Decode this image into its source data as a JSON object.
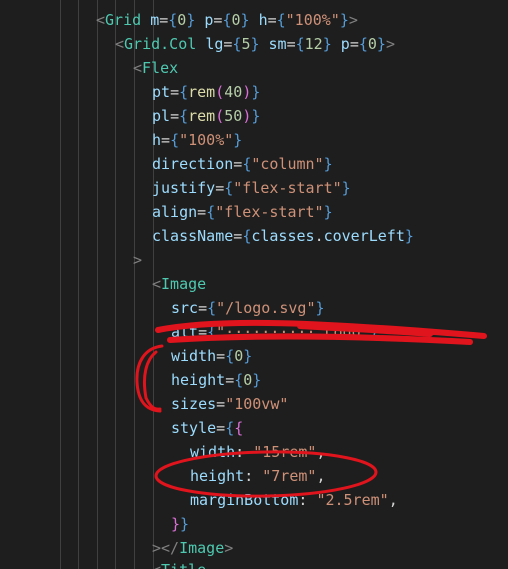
{
  "editor": {
    "lines": [
      [
        [
          "tag",
          "<"
        ],
        [
          "comp",
          "Grid"
        ],
        [
          "op",
          " "
        ],
        [
          "attr",
          "m"
        ],
        [
          "op",
          "="
        ],
        [
          "br",
          "{"
        ],
        [
          "num",
          "0"
        ],
        [
          "br",
          "}"
        ],
        [
          "op",
          " "
        ],
        [
          "attr",
          "p"
        ],
        [
          "op",
          "="
        ],
        [
          "br",
          "{"
        ],
        [
          "num",
          "0"
        ],
        [
          "br",
          "}"
        ],
        [
          "op",
          " "
        ],
        [
          "attr",
          "h"
        ],
        [
          "op",
          "="
        ],
        [
          "br",
          "{"
        ],
        [
          "str",
          "\"100%\""
        ],
        [
          "br",
          "}"
        ],
        [
          "tag",
          ">"
        ]
      ],
      [
        [
          "tag",
          "<"
        ],
        [
          "comp",
          "Grid.Col"
        ],
        [
          "op",
          " "
        ],
        [
          "attr",
          "lg"
        ],
        [
          "op",
          "="
        ],
        [
          "br",
          "{"
        ],
        [
          "num",
          "5"
        ],
        [
          "br",
          "}"
        ],
        [
          "op",
          " "
        ],
        [
          "attr",
          "sm"
        ],
        [
          "op",
          "="
        ],
        [
          "br",
          "{"
        ],
        [
          "num",
          "12"
        ],
        [
          "br",
          "}"
        ],
        [
          "op",
          " "
        ],
        [
          "attr",
          "p"
        ],
        [
          "op",
          "="
        ],
        [
          "br",
          "{"
        ],
        [
          "num",
          "0"
        ],
        [
          "br",
          "}"
        ],
        [
          "tag",
          ">"
        ]
      ],
      [
        [
          "tag",
          "<"
        ],
        [
          "comp",
          "Flex"
        ]
      ],
      [
        [
          "attr",
          "pt"
        ],
        [
          "op",
          "="
        ],
        [
          "br",
          "{"
        ],
        [
          "fn",
          "rem"
        ],
        [
          "br2",
          "("
        ],
        [
          "num",
          "40"
        ],
        [
          "br2",
          ")"
        ],
        [
          "br",
          "}"
        ]
      ],
      [
        [
          "attr",
          "pl"
        ],
        [
          "op",
          "="
        ],
        [
          "br",
          "{"
        ],
        [
          "fn",
          "rem"
        ],
        [
          "br2",
          "("
        ],
        [
          "num",
          "50"
        ],
        [
          "br2",
          ")"
        ],
        [
          "br",
          "}"
        ]
      ],
      [
        [
          "attr",
          "h"
        ],
        [
          "op",
          "="
        ],
        [
          "br",
          "{"
        ],
        [
          "str",
          "\"100%\""
        ],
        [
          "br",
          "}"
        ]
      ],
      [
        [
          "attr",
          "direction"
        ],
        [
          "op",
          "="
        ],
        [
          "br",
          "{"
        ],
        [
          "str",
          "\"column\""
        ],
        [
          "br",
          "}"
        ]
      ],
      [
        [
          "attr",
          "justify"
        ],
        [
          "op",
          "="
        ],
        [
          "br",
          "{"
        ],
        [
          "str",
          "\"flex-start\""
        ],
        [
          "br",
          "}"
        ]
      ],
      [
        [
          "attr",
          "align"
        ],
        [
          "op",
          "="
        ],
        [
          "br",
          "{"
        ],
        [
          "str",
          "\"flex-start\""
        ],
        [
          "br",
          "}"
        ]
      ],
      [
        [
          "attr",
          "className"
        ],
        [
          "op",
          "="
        ],
        [
          "br",
          "{"
        ],
        [
          "attr",
          "classes"
        ],
        [
          "op",
          "."
        ],
        [
          "attr",
          "coverLeft"
        ],
        [
          "br",
          "}"
        ]
      ],
      [
        [
          "fold",
          ">"
        ]
      ],
      [
        [
          "tag",
          "<"
        ],
        [
          "comp",
          "Image"
        ]
      ],
      [
        [
          "attr",
          "src"
        ],
        [
          "op",
          "="
        ],
        [
          "br",
          "{"
        ],
        [
          "str",
          "\"/logo.svg\""
        ],
        [
          "br",
          "}"
        ]
      ],
      [
        [
          "attr",
          "alt"
        ],
        [
          "op",
          "="
        ],
        [
          "br",
          "{"
        ],
        [
          "str",
          "\"·········· Logo\""
        ],
        [
          "br",
          "}"
        ]
      ],
      [
        [
          "attr",
          "width"
        ],
        [
          "op",
          "="
        ],
        [
          "br",
          "{"
        ],
        [
          "num",
          "0"
        ],
        [
          "br",
          "}"
        ]
      ],
      [
        [
          "attr",
          "height"
        ],
        [
          "op",
          "="
        ],
        [
          "br",
          "{"
        ],
        [
          "num",
          "0"
        ],
        [
          "br",
          "}"
        ]
      ],
      [
        [
          "attr",
          "sizes"
        ],
        [
          "op",
          "="
        ],
        [
          "str",
          "\"100vw\""
        ]
      ],
      [
        [
          "attr",
          "style"
        ],
        [
          "op",
          "="
        ],
        [
          "br",
          "{"
        ],
        [
          "br2",
          "{"
        ]
      ],
      [
        [
          "attr",
          "width"
        ],
        [
          "op",
          ": "
        ],
        [
          "str",
          "\"15rem\""
        ],
        [
          "op",
          ","
        ]
      ],
      [
        [
          "attr",
          "height"
        ],
        [
          "op",
          ": "
        ],
        [
          "str",
          "\"7rem\""
        ],
        [
          "op",
          ","
        ]
      ],
      [
        [
          "attr",
          "marginBottom"
        ],
        [
          "op",
          ": "
        ],
        [
          "str",
          "\"2.5rem\""
        ],
        [
          "op",
          ","
        ]
      ],
      [
        [
          "br2",
          "}"
        ],
        [
          "br",
          "}"
        ]
      ],
      [
        [
          "tag",
          "></"
        ],
        [
          "comp",
          "Image"
        ],
        [
          "tag",
          ">"
        ]
      ],
      [
        [
          "tag",
          "<"
        ],
        [
          "comp",
          "Title"
        ]
      ]
    ],
    "colors": {
      "background": "#1e1e1e",
      "annotation_red": "#e0141c"
    }
  }
}
